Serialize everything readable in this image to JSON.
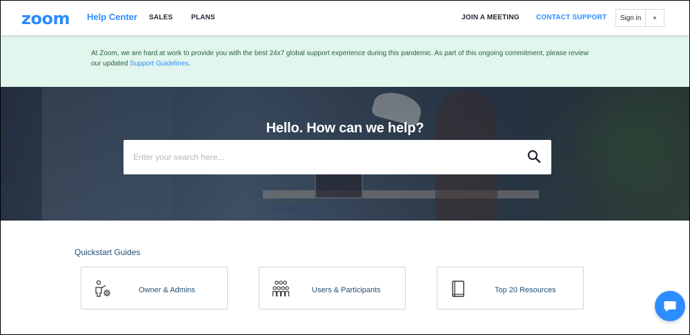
{
  "header": {
    "logo": "zoom",
    "help_center": "Help Center",
    "nav": {
      "sales": "SALES",
      "plans": "PLANS",
      "join": "JOIN A MEETING",
      "contact": "CONTACT SUPPORT"
    },
    "signin": "Sign in",
    "signin_caret": "▼"
  },
  "notice": {
    "text": "At Zoom, we are hard at work to provide you with the best 24x7 global support experience during this pandemic. As part of this ongoing commitment, please review our updated ",
    "link": "Support Guidelines",
    "suffix": "."
  },
  "hero": {
    "title": "Hello. How can we help?",
    "search_placeholder": "Enter your search here..."
  },
  "quickstart": {
    "title": "Quickstart Guides",
    "cards": [
      {
        "label": "Owner & Admins",
        "icon": "admin-gear-icon"
      },
      {
        "label": "Users & Participants",
        "icon": "participants-icon"
      },
      {
        "label": "Top 20 Resources",
        "icon": "book-icon"
      }
    ]
  },
  "colors": {
    "brand": "#2d8cff",
    "notice_bg": "#e1f6ed",
    "heading": "#1e4c73"
  }
}
